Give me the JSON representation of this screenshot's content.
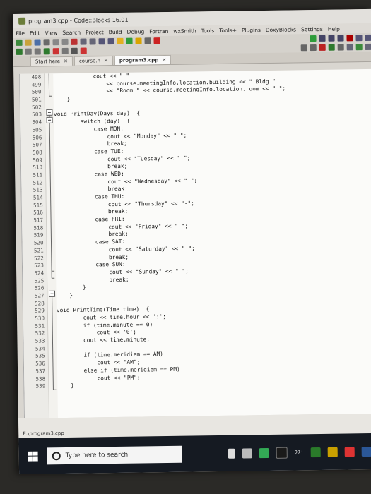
{
  "window": {
    "title": "program3.cpp - Code::Blocks 16.01"
  },
  "menu": [
    "File",
    "Edit",
    "View",
    "Search",
    "Project",
    "Build",
    "Debug",
    "Fortran",
    "wxSmith",
    "Tools",
    "Tools+",
    "Plugins",
    "DoxyBlocks",
    "Settings",
    "Help"
  ],
  "tabs": [
    {
      "label": "Start here"
    },
    {
      "label": "course.h"
    },
    {
      "label": "program3.cpp"
    }
  ],
  "code": {
    "line_numbers": [
      "498",
      "499",
      "500",
      "501",
      "502",
      "503",
      "504",
      "505",
      "506",
      "507",
      "508",
      "509",
      "510",
      "511",
      "512",
      "513",
      "514",
      "515",
      "516",
      "517",
      "518",
      "519",
      "520",
      "521",
      "522",
      "523",
      "524",
      "525",
      "526",
      "527",
      "528",
      "529",
      "530",
      "531",
      "532",
      "533",
      "534",
      "535",
      "536",
      "537",
      "538",
      "539"
    ],
    "text": {
      "l498": "            cout << \" \"",
      "l499": "                << course.meetingInfo.location.building << \" Bldg \"",
      "l500": "                << \"Room \" << course.meetingInfo.location.room << \" \";",
      "l501": "    }",
      "l502": "",
      "l503": "void PrintDay(Days day)  {",
      "l504": "        switch (day)  {",
      "l505": "            case MON:",
      "l506": "                cout << \"Monday\" << \" \";",
      "l507": "                break;",
      "l508": "            case TUE:",
      "l509": "                cout << \"Tuesday\" << \" \";",
      "l510": "                break;",
      "l511": "            case WED:",
      "l512": "                cout << \"Wednesday\" << \" \";",
      "l513": "                break;",
      "l514": "            case THU:",
      "l515": "                cout << \"Thursday\" << \"-\";",
      "l516": "                break;",
      "l517": "            case FRI:",
      "l518": "                cout << \"Friday\" << \" \";",
      "l519": "                break;",
      "l520": "            case SAT:",
      "l521": "                cout << \"Saturday\" << \" \";",
      "l522": "                break;",
      "l523": "            case SUN:",
      "l524": "                cout << \"Sunday\" << \" \";",
      "l525": "                break;",
      "l526": "        }",
      "l527": "    }",
      "l528": "",
      "l529": "void PrintTime(Time time)  {",
      "l530": "        cout << time.hour << ':';",
      "l531": "        if (time.minute == 0)",
      "l532": "            cout << '0';",
      "l533": "        cout << time.minute;",
      "l534": "",
      "l535": "        if (time.meridiem == AM)",
      "l536": "            cout << \"AM\";",
      "l537": "        else if (time.meridiem == PM)",
      "l538": "            cout << \"PM\";",
      "l539": "    }"
    }
  },
  "statusbar": {
    "path": "E:\\program3.cpp"
  },
  "taskbar": {
    "search_placeholder": "Type here to search",
    "badge": "99+"
  }
}
